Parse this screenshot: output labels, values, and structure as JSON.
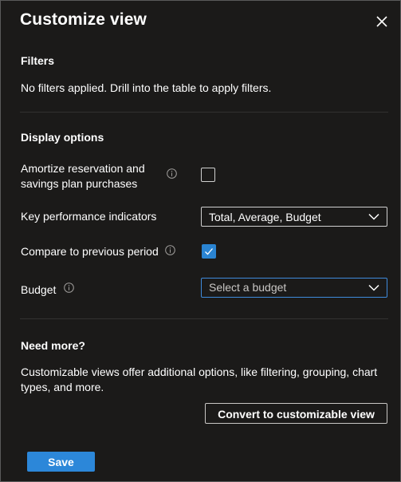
{
  "header": {
    "title": "Customize view",
    "close_icon": "close-icon"
  },
  "filters": {
    "heading": "Filters",
    "message": "No filters applied. Drill into the table to apply filters."
  },
  "display_options": {
    "heading": "Display options",
    "amortize": {
      "label_line1": "Amortize reservation and",
      "label_line2": "savings plan purchases",
      "checked": false
    },
    "kpi": {
      "label": "Key performance indicators",
      "value": "Total, Average, Budget"
    },
    "compare": {
      "label": "Compare to previous period",
      "checked": true
    },
    "budget": {
      "label": "Budget",
      "placeholder": "Select a budget"
    }
  },
  "need_more": {
    "heading": "Need more?",
    "line1": "Customizable views offer additional options, like filtering, grouping, chart",
    "line2": "types, and more.",
    "convert_label": "Convert to customizable view"
  },
  "footer": {
    "save_label": "Save"
  },
  "colors": {
    "background": "#1b1a19",
    "accent": "#2c87d9",
    "border": "#d0d0d0",
    "divider": "#323130"
  }
}
